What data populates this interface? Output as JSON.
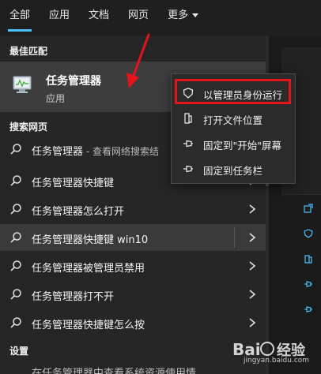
{
  "tabs": [
    {
      "label": "全部",
      "active": true
    },
    {
      "label": "应用"
    },
    {
      "label": "文档"
    },
    {
      "label": "网页"
    },
    {
      "label": "更多"
    }
  ],
  "sections": {
    "best_match": "最佳匹配",
    "search_web": "搜索网页",
    "settings": "设置"
  },
  "best_match": {
    "title": "任务管理器",
    "subtitle": "应用",
    "icon": "task-manager-icon"
  },
  "web_results": [
    {
      "label": "任务管理器",
      "suffix": " - 查看网络搜索结"
    },
    {
      "label": "任务管理器快捷键"
    },
    {
      "label": "任务管理器怎么打开"
    },
    {
      "label": "任务管理器快捷键 win10",
      "highlighted": true
    },
    {
      "label": "任务管理器被管理员禁用"
    },
    {
      "label": "任务管理器打不开"
    },
    {
      "label": "任务管理器快捷键怎么按"
    }
  ],
  "settings_partial": "在任务管理器中查看系统资源使用情",
  "context_menu": [
    {
      "label": "以管理员身份运行",
      "icon": "shield-icon"
    },
    {
      "label": "打开文件位置",
      "icon": "folder-icon"
    },
    {
      "label": "固定到\"开始\"屏幕",
      "icon": "pin-icon"
    },
    {
      "label": "固定到任务栏",
      "icon": "pin-icon"
    }
  ],
  "watermark": {
    "site": "jingyan.baidu.com"
  },
  "colors": {
    "accent": "#4cc2ff",
    "highlight_box": "#e3141c",
    "background": "#1f1f1f"
  }
}
